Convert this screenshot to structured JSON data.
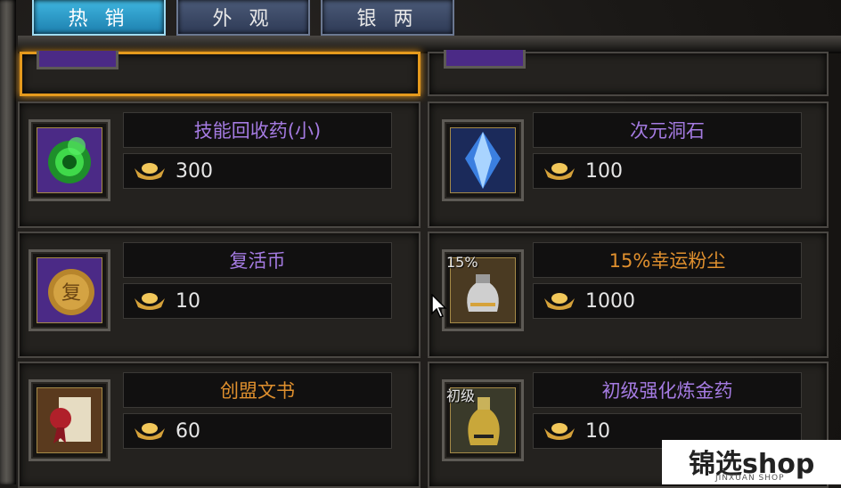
{
  "tabs": [
    {
      "label": "热 销",
      "active": true
    },
    {
      "label": "外 观",
      "active": false
    },
    {
      "label": "银 两",
      "active": false
    }
  ],
  "items": [
    {
      "name": "技能回收药(小)",
      "price": "300",
      "name_color": "purple",
      "icon": "green-orb-icon",
      "icon_text": ""
    },
    {
      "name": "次元洞石",
      "price": "100",
      "name_color": "purple",
      "icon": "blue-crystal-icon",
      "icon_text": ""
    },
    {
      "name": "复活币",
      "price": "10",
      "name_color": "purple",
      "icon": "revive-coin-icon",
      "icon_text": ""
    },
    {
      "name": "15%幸运粉尘",
      "price": "1000",
      "name_color": "orange",
      "icon": "dust-bag-icon",
      "icon_text": "15%"
    },
    {
      "name": "创盟文书",
      "price": "60",
      "name_color": "orange",
      "icon": "scroll-seal-icon",
      "icon_text": ""
    },
    {
      "name": "初级强化炼金药",
      "price": "10",
      "name_color": "purple",
      "icon": "alchemy-bottle-icon",
      "icon_text": "初级"
    }
  ],
  "currency_icon": "gold-ingot-icon",
  "watermark": {
    "main": "锦选shop",
    "sub": "JINXUAN SHOP"
  },
  "colors": {
    "active_tab": "#2a9fd0",
    "selected_border": "#e59a1d",
    "purple_text": "#a57be2",
    "orange_text": "#e0902e"
  }
}
